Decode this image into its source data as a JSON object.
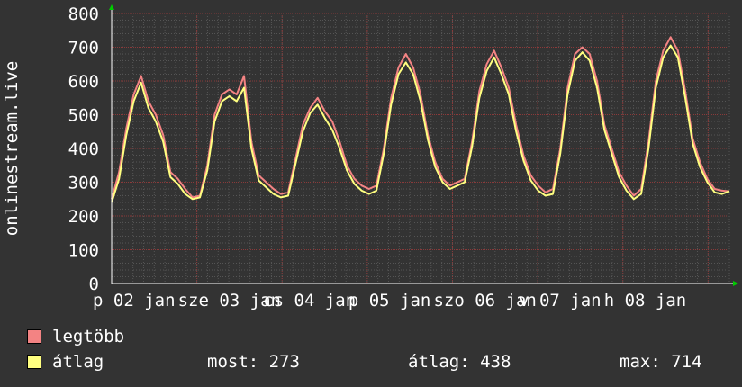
{
  "chart_data": {
    "type": "line",
    "ylabel": "onlinestream.live",
    "ylim": [
      0,
      800
    ],
    "yticks": [
      0,
      100,
      200,
      300,
      400,
      500,
      600,
      700,
      800
    ],
    "xtick_labels": [
      "p 02 jan",
      "sze 03 jan",
      "cs 04 jan",
      "p 05 jan",
      "szo 06 jan",
      "v 07 jan",
      "h 08 jan"
    ],
    "x_day_range": [
      0,
      7.25
    ],
    "grid": true,
    "background": "#333333",
    "series": [
      {
        "name": "legtöbb",
        "color": "#f38383",
        "values": [
          250,
          330,
          460,
          560,
          615,
          540,
          500,
          440,
          330,
          310,
          280,
          255,
          260,
          350,
          500,
          560,
          575,
          560,
          615,
          420,
          320,
          300,
          280,
          265,
          270,
          370,
          470,
          520,
          550,
          510,
          480,
          420,
          350,
          310,
          290,
          280,
          290,
          400,
          550,
          640,
          680,
          640,
          560,
          440,
          360,
          310,
          290,
          300,
          310,
          420,
          570,
          650,
          690,
          640,
          580,
          470,
          380,
          320,
          290,
          270,
          280,
          400,
          580,
          680,
          700,
          680,
          600,
          470,
          400,
          330,
          290,
          260,
          280,
          420,
          600,
          690,
          730,
          690,
          570,
          430,
          360,
          310,
          280,
          275,
          273
        ]
      },
      {
        "name": "átlag",
        "color": "#ffff80",
        "values": [
          240,
          310,
          440,
          540,
          595,
          520,
          480,
          420,
          315,
          295,
          265,
          250,
          255,
          335,
          480,
          540,
          555,
          540,
          580,
          400,
          305,
          285,
          265,
          255,
          260,
          355,
          450,
          505,
          530,
          490,
          455,
          400,
          335,
          295,
          275,
          265,
          275,
          385,
          530,
          620,
          655,
          620,
          540,
          425,
          345,
          300,
          280,
          290,
          300,
          405,
          550,
          630,
          670,
          620,
          560,
          450,
          365,
          305,
          275,
          260,
          265,
          385,
          560,
          660,
          685,
          660,
          580,
          455,
          385,
          315,
          275,
          250,
          265,
          400,
          580,
          670,
          705,
          670,
          550,
          415,
          345,
          300,
          270,
          265,
          273
        ]
      }
    ]
  },
  "legend": {
    "items": [
      {
        "label": "legtöbb",
        "color": "#f38383"
      },
      {
        "label": "átlag",
        "color": "#ffff80"
      }
    ],
    "stats": {
      "now": "most: 273",
      "avg": "átlag: 438",
      "max": "max: 714"
    }
  }
}
